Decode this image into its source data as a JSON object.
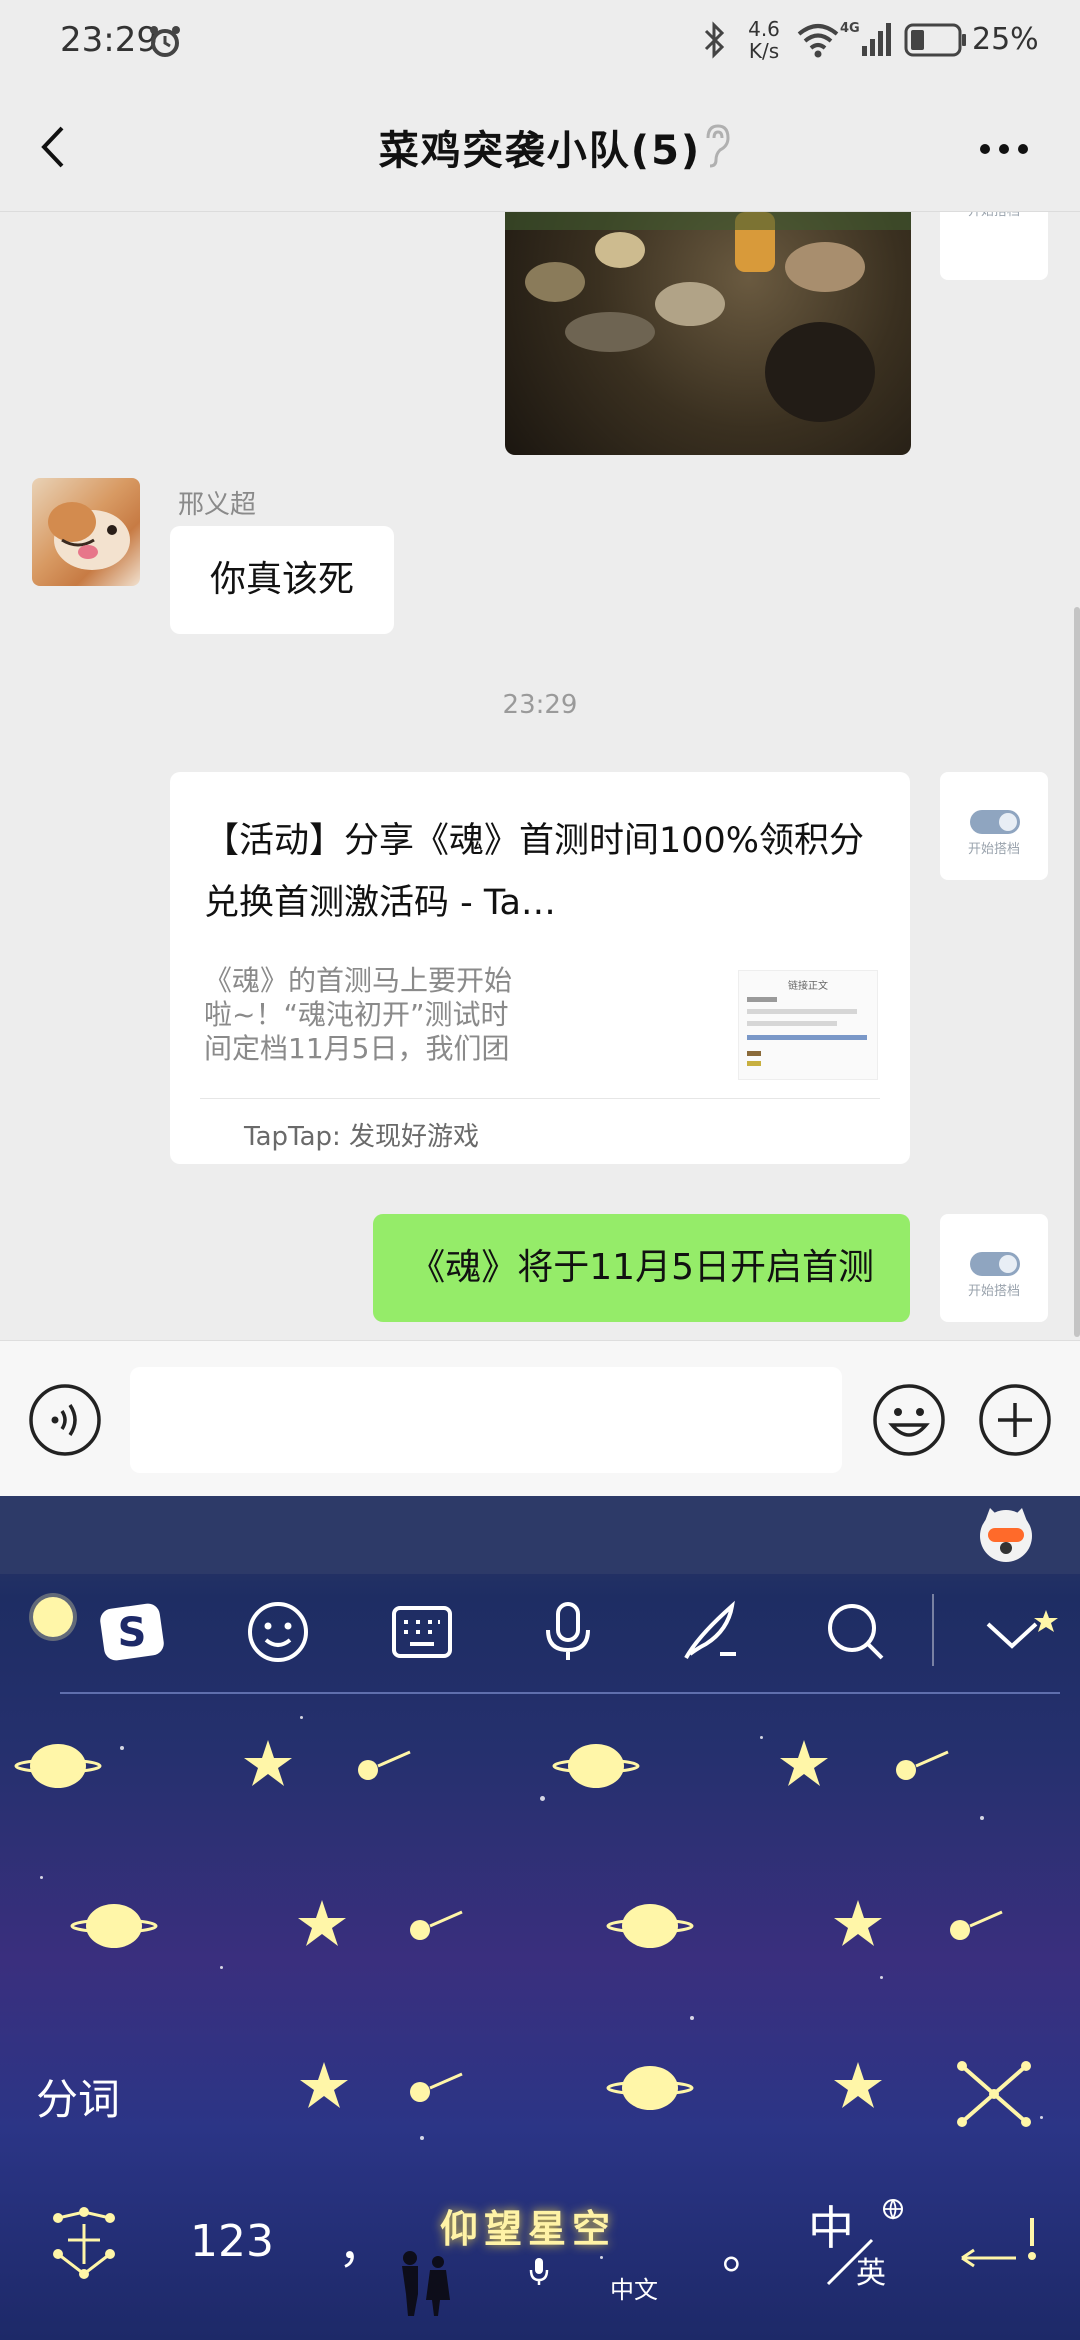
{
  "status_bar": {
    "time": "23:29",
    "net_speed_value": "4.6",
    "net_speed_unit": "K/s",
    "network_type": "4G",
    "battery": "25%"
  },
  "nav": {
    "title": "菜鸡突袭小队(5)"
  },
  "messages": {
    "sender_name": "邢义超",
    "incoming_text": "你真该死",
    "time_divider": "23:29",
    "card_title": "【活动】分享《魂》首测时间100%领积分兑换首测激活码 - Ta…",
    "card_desc": "《魂》的首测马上要开始啦~！“魂沌初开”测试时间定档11月5日，我们团队所有人…",
    "card_source": "TapTap: 发现好游戏",
    "card_thumb_title": "链接正文",
    "outgoing_text": "《魂》将于11月5日开启首测",
    "avatar_caption": "开始搭档"
  },
  "input": {
    "value": "",
    "placeholder": ""
  },
  "keyboard": {
    "seg_word": "分词",
    "number_key": "123",
    "comma": "，",
    "space_label": "仰望星空",
    "space_lang_hint": "中文",
    "period": "。",
    "lang_zh": "中",
    "lang_en": "英",
    "accent_color": "#f5e27a"
  },
  "colors": {
    "outgoing_bubble": "#95ec69",
    "background": "#ededed"
  }
}
